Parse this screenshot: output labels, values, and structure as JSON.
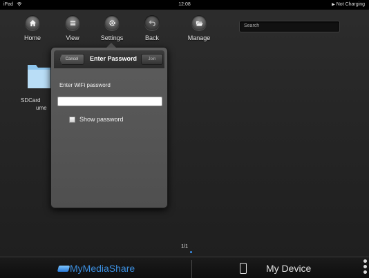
{
  "status_bar": {
    "device": "iPad",
    "time": "12:08",
    "battery": "Not Charging"
  },
  "toolbar": {
    "items": [
      {
        "label": "Home",
        "icon": "home-icon"
      },
      {
        "label": "View",
        "icon": "list-icon"
      },
      {
        "label": "Settings",
        "icon": "gear-icon"
      },
      {
        "label": "Back",
        "icon": "back-arrow-icon"
      },
      {
        "label": "Manage",
        "icon": "folder-open-icon"
      }
    ],
    "search_placeholder": "Search"
  },
  "background_item": {
    "label_line1": "SDCard",
    "label_line2": "ume"
  },
  "dialog": {
    "cancel_label": "Cancel",
    "title": "Enter Password",
    "join_label": "Join",
    "prompt": "Enter WiFi password",
    "password_value": "",
    "show_password_label": "Show password",
    "show_password_checked": false
  },
  "pager": {
    "text": "1/1"
  },
  "bottom_bar": {
    "left_label": "MyMediaShare",
    "right_label": "My Device"
  },
  "colors": {
    "accent": "#3c8fe0",
    "background": "#262626",
    "popover": "#555555"
  }
}
